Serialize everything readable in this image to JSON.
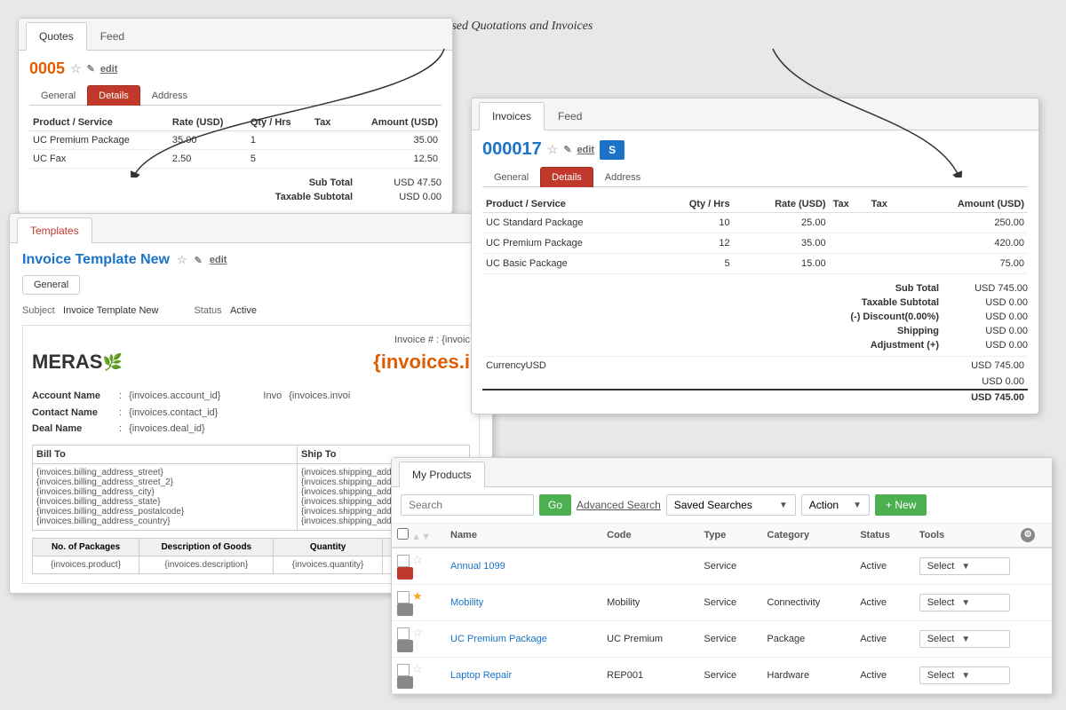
{
  "annotation": {
    "text": "Template based Quotations and Invoices"
  },
  "quotes": {
    "tabs": [
      "Quotes",
      "Feed"
    ],
    "active_tab": "Quotes",
    "record_id": "0005",
    "edit_label": "edit",
    "sub_tabs": [
      "General",
      "Details",
      "Address"
    ],
    "active_sub_tab": "Details",
    "table_headers": [
      "Product / Service",
      "Rate (USD)",
      "Qty / Hrs",
      "Tax",
      "Amount (USD)"
    ],
    "rows": [
      {
        "product": "UC Premium Package",
        "rate": "35.00",
        "qty": "1",
        "tax": "",
        "amount": "35.00"
      },
      {
        "product": "UC Fax",
        "rate": "2.50",
        "qty": "5",
        "tax": "",
        "amount": "12.50"
      }
    ],
    "summary": [
      {
        "label": "Sub Total",
        "value": "USD 47.50"
      },
      {
        "label": "Taxable Subtotal",
        "value": "USD 0.00"
      }
    ]
  },
  "templates": {
    "tab_label": "Templates",
    "title": "Invoice Template New",
    "edit_label": "edit",
    "general_tab": "General",
    "subject_label": "Subject",
    "subject_value": "Invoice Template New",
    "status_label": "Status",
    "status_value": "Active",
    "invoice_num_placeholder": "Invoice # : {invoic",
    "invoice_title_placeholder": "{invoices.i",
    "account_name_label": "Account Name",
    "account_name_value": "{invoices.account_id}",
    "invoice_label": "Invo",
    "invoice_value": "{invoices.invoi",
    "contact_name_label": "Contact Name",
    "contact_name_value": "{invoices.contact_id}",
    "deal_name_label": "Deal Name",
    "deal_name_value": "{invoices.deal_id}",
    "bill_to_label": "Bill To",
    "ship_to_label": "Ship To",
    "bill_fields": [
      "{invoices.billing_address_street}",
      "{invoices.billing_address_street_2}",
      "{invoices.billing_address_city}",
      "{invoices.billing_address_state}",
      "{invoices.billing_address_postalcode}",
      "{invoices.billing_address_country}"
    ],
    "ship_fields": [
      "{invoices.shipping_addr",
      "{invoices.shipping_addr",
      "{invoices.shipping_addr",
      "{invoices.shipping_addr",
      "{invoices.shipping_addr",
      "{invoices.shipping_add"
    ],
    "goods_headers": [
      "No. of Packages",
      "Description of Goods",
      "Quantity",
      "Unit Value"
    ],
    "goods_rows": [
      [
        "{invoices.product}",
        "{invoices.description}",
        "{invoices.quantity}",
        "{invoices.rate}"
      ]
    ]
  },
  "invoices": {
    "tabs": [
      "Invoices",
      "Feed"
    ],
    "active_tab": "Invoices",
    "record_id": "000017",
    "edit_label": "edit",
    "sub_tabs": [
      "General",
      "Details",
      "Address"
    ],
    "active_sub_tab": "Details",
    "table_headers": [
      "Product / Service",
      "Qty / Hrs",
      "Rate (USD)",
      "Tax",
      "Tax",
      "Amount (USD)"
    ],
    "rows": [
      {
        "product": "UC Standard Package",
        "qty": "10",
        "rate": "25.00",
        "tax1": "",
        "tax2": "",
        "amount": "250.00"
      },
      {
        "product": "UC Premium Package",
        "qty": "12",
        "rate": "35.00",
        "tax1": "",
        "tax2": "",
        "amount": "420.00"
      },
      {
        "product": "UC Basic Package",
        "qty": "5",
        "rate": "15.00",
        "tax1": "",
        "tax2": "",
        "amount": "75.00"
      }
    ],
    "summary": [
      {
        "label": "Sub Total",
        "value": "USD 745.00"
      },
      {
        "label": "Taxable Subtotal",
        "value": "USD 0.00"
      },
      {
        "label": "(-) Discount(0.00%)",
        "value": "USD 0.00"
      },
      {
        "label": "Shipping",
        "value": "USD 0.00"
      },
      {
        "label": "Adjustment (+)",
        "value": "USD 0.00"
      }
    ],
    "totals": [
      {
        "value": "USD 745.00"
      },
      {
        "value": "USD 0.00"
      },
      {
        "value": "USD 745.00"
      }
    ],
    "currency_label": "Currency",
    "currency_value": "USD"
  },
  "products": {
    "tab_label": "My Products",
    "search_placeholder": "Search",
    "go_label": "Go",
    "adv_search_label": "Advanced Search",
    "saved_searches_label": "Saved Searches",
    "action_label": "Action",
    "new_label": "+ New",
    "columns": [
      "",
      "Name",
      "Code",
      "Type",
      "Category",
      "Status",
      "Tools",
      ""
    ],
    "rows": [
      {
        "name": "Annual 1099",
        "code": "",
        "type": "Service",
        "category": "",
        "status": "Active",
        "tools": "Select",
        "starred": false,
        "icon_red": true
      },
      {
        "name": "Mobility",
        "code": "Mobility",
        "type": "Service",
        "category": "Connectivity",
        "status": "Active",
        "tools": "Select",
        "starred": true,
        "icon_red": false
      },
      {
        "name": "UC Premium Package",
        "code": "UC Premium",
        "type": "Service",
        "category": "Package",
        "status": "Active",
        "tools": "Select",
        "starred": false,
        "icon_red": false
      },
      {
        "name": "Laptop Repair",
        "code": "REP001",
        "type": "Service",
        "category": "Hardware",
        "status": "Active",
        "tools": "Select",
        "starred": false,
        "icon_red": false
      }
    ]
  }
}
